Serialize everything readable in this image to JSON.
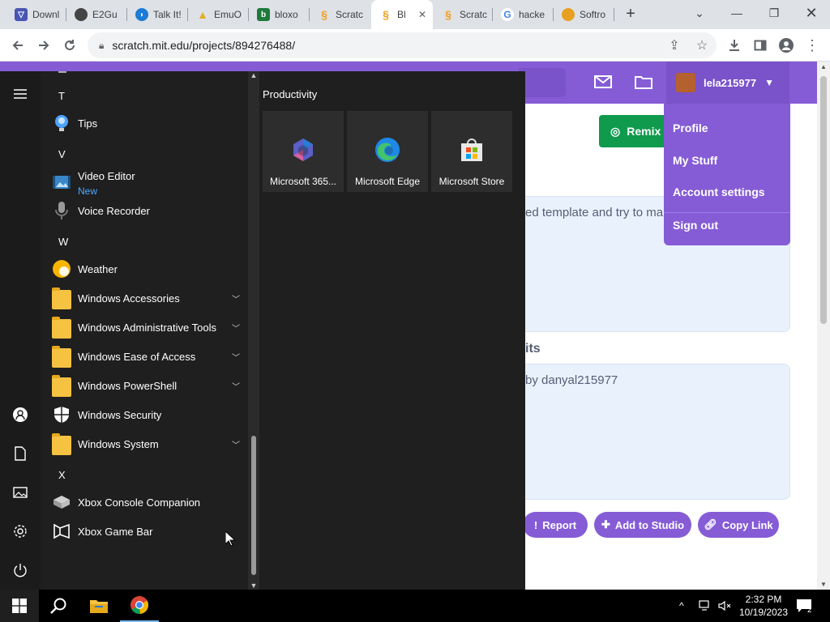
{
  "browser": {
    "tabs": [
      {
        "label": "Downl",
        "color": "#4a56b3",
        "icon": "download-favicon"
      },
      {
        "label": "E2Gu",
        "color": "#444444",
        "icon": "e2guide-favicon"
      },
      {
        "label": "Talk It!",
        "color": "#1b7bd6",
        "icon": "talkit-favicon"
      },
      {
        "label": "EmuO",
        "color": "#e0b020",
        "icon": "emu-favicon"
      },
      {
        "label": "bloxo",
        "color": "#1d7a3a",
        "icon": "bloxd-favicon"
      },
      {
        "label": "Scratc",
        "color": "#f0a020",
        "icon": "scratch-favicon"
      },
      {
        "label": "Bl",
        "color": "#f0a020",
        "icon": "scratch-favicon"
      },
      {
        "label": "Scratc",
        "color": "#f0a020",
        "icon": "scratch-favicon"
      },
      {
        "label": "hacke",
        "color": "#4285f4",
        "icon": "google-favicon"
      },
      {
        "label": "Softro",
        "color": "#e8a020",
        "icon": "softros-favicon"
      }
    ],
    "url": "scratch.mit.edu/projects/894276488/"
  },
  "scratch": {
    "username": "lela215977",
    "menu": [
      "Profile",
      "My Stuff",
      "Account settings",
      "Sign out"
    ],
    "remix_label": "Remix",
    "instructions_fragment": "ed template and try to ma",
    "credits_heading": "its",
    "credits_text": "by danyal215977",
    "buttons": {
      "report": "Report",
      "add_to_studio": "Add to Studio",
      "copy_link": "Copy Link"
    }
  },
  "start_menu": {
    "letters": {
      "t": "T",
      "v": "V",
      "w": "W",
      "x": "X"
    },
    "apps": {
      "tips": "Tips",
      "video_editor": "Video Editor",
      "video_editor_badge": "New",
      "voice_recorder": "Voice Recorder",
      "weather": "Weather",
      "win_accessories": "Windows Accessories",
      "win_admin_tools": "Windows Administrative Tools",
      "win_ease": "Windows Ease of Access",
      "win_powershell": "Windows PowerShell",
      "win_security": "Windows Security",
      "win_system": "Windows System",
      "xbox_companion": "Xbox Console Companion",
      "xbox_gamebar": "Xbox Game Bar"
    },
    "group_title": "Productivity",
    "tiles": [
      "Microsoft 365...",
      "Microsoft Edge",
      "Microsoft Store"
    ]
  },
  "taskbar": {
    "time": "2:32 PM",
    "date": "10/19/2023",
    "notifications": "2"
  }
}
